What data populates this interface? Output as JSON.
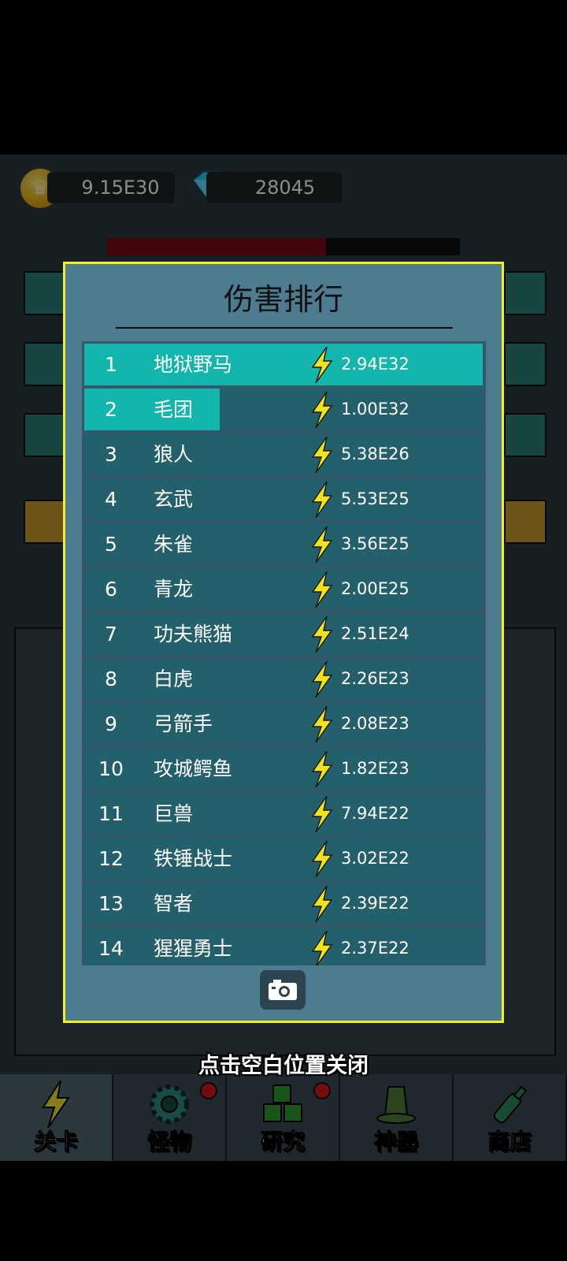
{
  "header": {
    "gold": "9.15E30",
    "diamonds": "28045",
    "colors": {
      "gold_icon": "#e0a000",
      "diamond_icon": "#2fc6f0"
    }
  },
  "modal": {
    "title": "伤害排行",
    "close_hint": "点击空白位置关闭",
    "rows": [
      {
        "rank": "1",
        "name": "地狱野马",
        "damage": "2.94E32",
        "share": 1.0
      },
      {
        "rank": "2",
        "name": "毛团",
        "damage": "1.00E32",
        "share": 0.34
      },
      {
        "rank": "3",
        "name": "狼人",
        "damage": "5.38E26",
        "share": 0
      },
      {
        "rank": "4",
        "name": "玄武",
        "damage": "5.53E25",
        "share": 0
      },
      {
        "rank": "5",
        "name": "朱雀",
        "damage": "3.56E25",
        "share": 0
      },
      {
        "rank": "6",
        "name": "青龙",
        "damage": "2.00E25",
        "share": 0
      },
      {
        "rank": "7",
        "name": "功夫熊猫",
        "damage": "2.51E24",
        "share": 0
      },
      {
        "rank": "8",
        "name": "白虎",
        "damage": "2.26E23",
        "share": 0
      },
      {
        "rank": "9",
        "name": "弓箭手",
        "damage": "2.08E23",
        "share": 0
      },
      {
        "rank": "10",
        "name": "攻城鳄鱼",
        "damage": "1.82E23",
        "share": 0
      },
      {
        "rank": "11",
        "name": "巨兽",
        "damage": "7.94E22",
        "share": 0
      },
      {
        "rank": "12",
        "name": "铁锤战士",
        "damage": "3.02E22",
        "share": 0
      },
      {
        "rank": "13",
        "name": "智者",
        "damage": "2.39E22",
        "share": 0
      },
      {
        "rank": "14",
        "name": "猩猩勇士",
        "damage": "2.37E22",
        "share": 0
      }
    ],
    "icons": {
      "damage": "lightning-icon",
      "screenshot": "camera-icon"
    }
  },
  "nav": {
    "items": [
      {
        "label": "关卡",
        "icon": "lightning-icon",
        "active": true,
        "badge": false
      },
      {
        "label": "怪物",
        "icon": "gear-icon",
        "active": false,
        "badge": true
      },
      {
        "label": "研究",
        "icon": "cubes-icon",
        "active": false,
        "badge": true
      },
      {
        "label": "神器",
        "icon": "hat-icon",
        "active": false,
        "badge": false
      },
      {
        "label": "商店",
        "icon": "bottle-icon",
        "active": false,
        "badge": false
      }
    ]
  }
}
